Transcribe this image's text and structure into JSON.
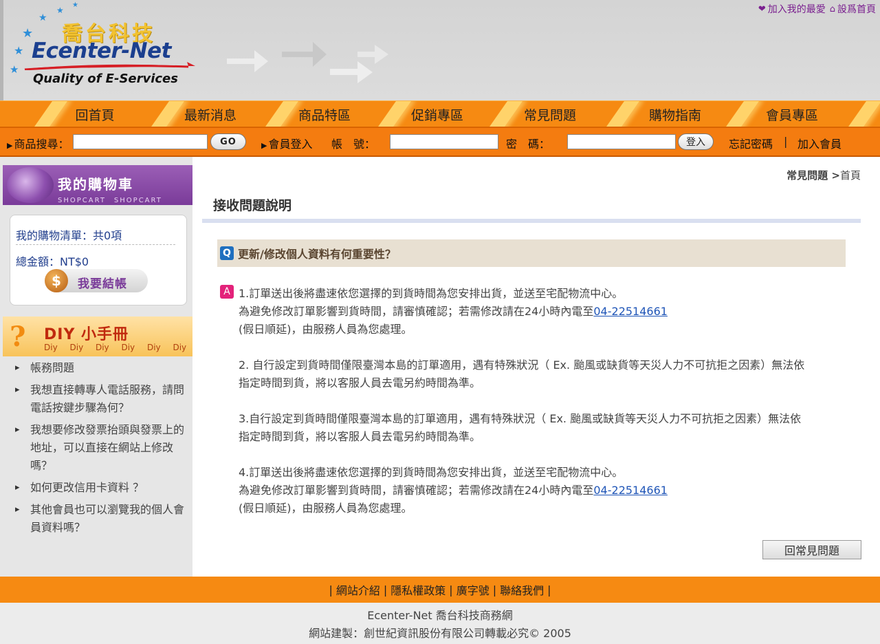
{
  "header": {
    "logo_cn": "喬台科技",
    "logo_en": "Ecenter-Net",
    "logo_tagline": "Quality of E-Services",
    "top_links": [
      {
        "label": "加入我的最愛",
        "icon": "heart-icon"
      },
      {
        "label": "設爲首頁",
        "icon": "home-icon"
      }
    ]
  },
  "nav": {
    "items": [
      "回首頁",
      "最新消息",
      "商品特區",
      "促銷專區",
      "常見問題",
      "購物指南",
      "會員專區"
    ]
  },
  "bar": {
    "search_label": "商品搜尋：",
    "go_label": "GO",
    "login_label": "會員登入",
    "account_label": "帳　號：",
    "password_label": "密　碼：",
    "login_button": "登入",
    "forgot_label": "忘記密碼",
    "separator": "|",
    "join_label": "加入會員"
  },
  "sidebar": {
    "cart_title": "我的購物車",
    "cart_sub": "SHOPCART　SHOPCART",
    "cart_list": "我的購物清單：共0項",
    "cart_total": "總金額：NT$0",
    "checkout_label": "我要結帳",
    "diy_title": "DIY 小手冊",
    "diy_sub": "Diy Diy Diy Diy Diy Diy",
    "faq_items": [
      "帳務問題",
      "我想直接轉專人電話服務，請問電話按鍵步驟為何？",
      "我想要修改發票抬頭與發票上的地址，可以直接在網站上修改嗎？",
      "如何更改信用卡資料 ？",
      "其他會員也可以瀏覽我的個人會員資料嗎？"
    ]
  },
  "main": {
    "breadcrumb_current": "常見問題",
    "breadcrumb_sep": " >",
    "breadcrumb_home": "首頁",
    "page_title": "接收問題說明",
    "question_badge": "Q",
    "question": "更新/修改個人資料有何重要性？",
    "answer_badge": "A",
    "answer": {
      "p1_line1": "1.訂單送出後將盡速依您選擇的到貨時間為您安排出貨，並送至宅配物流中心。",
      "p1_line2": "為避免修改訂單影響到貨時間，請審慎確認；若需修改請在24小時內電至",
      "p1_phone": "04-22514661",
      "p1_line3": "(假日順延)，由服務人員為您處理。",
      "p2_line1": "2. 自行設定到貨時間僅限臺灣本島的訂單適用，遇有特殊狀況（ Ex. 颱風或缺貨等天災人力不可抗拒之因素）無法依",
      "p2_line2": "指定時間到貨，將以客服人員去電另約時間為準。",
      "p3_line1": "3.自行設定到貨時間僅限臺灣本島的訂單適用，遇有特殊狀況（ Ex. 颱風或缺貨等天災人力不可抗拒之因素）無法依",
      "p3_line2": "指定時間到貨，將以客服人員去電另約時間為準。",
      "p4_line1": "4.訂單送出後將盡速依您選擇的到貨時間為您安排出貨，並送至宅配物流中心。",
      "p4_line2": "為避免修改訂單影響到貨時間，請審慎確認；若需修改請在24小時內電至",
      "p4_phone": "04-22514661",
      "p4_line3": "(假日順延)，由服務人員為您處理。"
    },
    "back_button": "回常見問題"
  },
  "footer": {
    "links": [
      "網站介紹",
      "隱私權政策",
      "廣字號",
      "聯絡我們"
    ],
    "pipe": "|",
    "line1": "Ecenter-Net 喬台科技商務網",
    "line2": "網站建製：創世紀資訊股份有限公司轉載必究© 2005"
  },
  "colors": {
    "nav_orange": "#f68a12",
    "cart_purple": "#7a3b99",
    "link_blue": "#1f55b7",
    "question_bg": "#e8e0d2"
  }
}
